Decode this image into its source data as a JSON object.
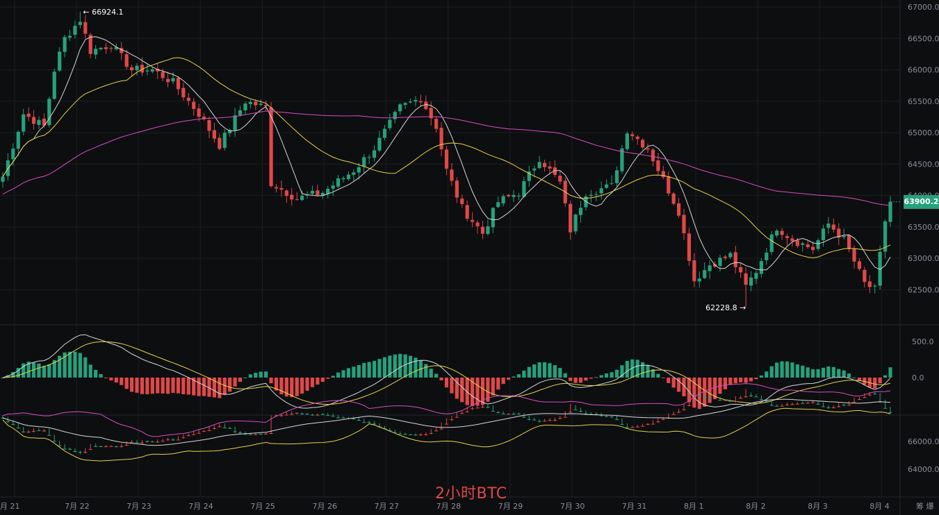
{
  "watermark": "2小时BTC",
  "last_price": "63900.2",
  "corner_label": "筹 爆",
  "colors": {
    "up": "#26a17b",
    "down": "#e04848",
    "ma_fast": "#d8d8d8",
    "ma_mid": "#e8d44a",
    "ma_slow": "#d84fc0",
    "background": "#0d0e10",
    "grid": "#1c1e22"
  },
  "chart_data": [
    {
      "type": "candlestick",
      "title": "",
      "x_labels": [
        "月 21",
        "7月 22",
        "7月 23",
        "7月 24",
        "7月 25",
        "7月 26",
        "7月 27",
        "7月 28",
        "7月 29",
        "7月 30",
        "7月 31",
        "8月 1",
        "8月 2",
        "8月 3",
        "8月 4"
      ],
      "y_ticks": [
        "67000.0",
        "66500.0",
        "66000.0",
        "65500.0",
        "65000.0",
        "64500.0",
        "64000.0",
        "63500.0",
        "63000.0",
        "62500.0"
      ],
      "ylim": [
        62100,
        67100
      ],
      "annotations": [
        {
          "text": "← 66924.1",
          "value": 66924.1,
          "kind": "high"
        },
        {
          "text": "62228.8 →",
          "value": 62228.8,
          "kind": "low"
        }
      ],
      "price_anchors": [
        [
          0,
          64300
        ],
        [
          4,
          65300
        ],
        [
          8,
          65100
        ],
        [
          10,
          66000
        ],
        [
          12,
          66500
        ],
        [
          15,
          66800
        ],
        [
          17,
          66300
        ],
        [
          21,
          66400
        ],
        [
          25,
          66000
        ],
        [
          29,
          66000
        ],
        [
          33,
          65800
        ],
        [
          38,
          65300
        ],
        [
          42,
          64800
        ],
        [
          47,
          65500
        ],
        [
          51,
          65400
        ],
        [
          52,
          64200
        ],
        [
          57,
          63950
        ],
        [
          62,
          64050
        ],
        [
          68,
          64400
        ],
        [
          72,
          64750
        ],
        [
          77,
          65400
        ],
        [
          81,
          65550
        ],
        [
          84,
          65100
        ],
        [
          86,
          64400
        ],
        [
          89,
          63800
        ],
        [
          93,
          63400
        ],
        [
          96,
          63900
        ],
        [
          100,
          64050
        ],
        [
          104,
          64600
        ],
        [
          108,
          64200
        ],
        [
          110,
          63450
        ],
        [
          113,
          64050
        ],
        [
          118,
          64150
        ],
        [
          121,
          65050
        ],
        [
          125,
          64750
        ],
        [
          128,
          64250
        ],
        [
          131,
          63750
        ],
        [
          134,
          62650
        ],
        [
          137,
          62900
        ],
        [
          141,
          63050
        ],
        [
          144,
          62550
        ],
        [
          146,
          62800
        ],
        [
          150,
          63500
        ],
        [
          153,
          63300
        ],
        [
          157,
          63150
        ],
        [
          160,
          63550
        ],
        [
          163,
          63300
        ],
        [
          167,
          62600
        ],
        [
          169,
          62500
        ],
        [
          171,
          63600
        ],
        [
          172,
          63900.2
        ]
      ],
      "ma_periods": [
        7,
        25,
        99
      ]
    },
    {
      "type": "macd",
      "y_ticks": [
        "500.0",
        "0.0"
      ],
      "ylim": [
        -1000,
        1000
      ]
    },
    {
      "type": "bollinger",
      "y_ticks": [
        "66000.0",
        "64000.0"
      ],
      "ylim": [
        62000,
        67500
      ]
    }
  ]
}
